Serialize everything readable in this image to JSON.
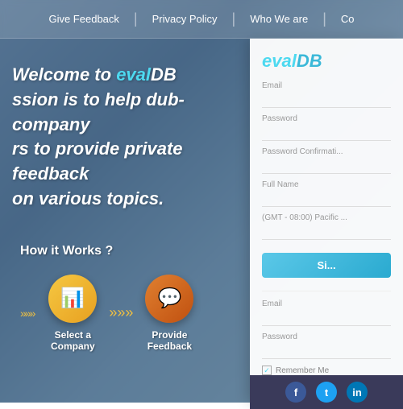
{
  "navbar": {
    "links": [
      {
        "label": "Give Feedback",
        "name": "give-feedback-link"
      },
      {
        "label": "Privacy Policy",
        "name": "privacy-policy-link"
      },
      {
        "label": "Who We are",
        "name": "who-we-are-link"
      },
      {
        "label": "Co",
        "name": "contact-link"
      }
    ]
  },
  "hero": {
    "welcome_line1": "Welcome to ",
    "brand_eval": "eval",
    "brand_db": "DB",
    "tagline_lines": [
      "ssion is to help dub-company",
      "rs to provide private feedback",
      "on various topics."
    ]
  },
  "how_it_works": {
    "title": "How it Works ?",
    "steps": [
      {
        "label": "Select a Company",
        "icon": "📊",
        "style": "yellow"
      },
      {
        "label": "Provide Feedback",
        "icon": "💬",
        "style": "orange"
      }
    ]
  },
  "signup_card": {
    "brand_eval": "eval",
    "brand_db": "DB",
    "fields": [
      {
        "label": "Email",
        "name": "email-signup"
      },
      {
        "label": "Password",
        "name": "password-signup"
      },
      {
        "label": "Password Confirmati...",
        "name": "password-confirm"
      },
      {
        "label": "Full Name",
        "name": "full-name"
      },
      {
        "label": "(GMT - 08:00) Pacific ...",
        "name": "timezone"
      }
    ],
    "signup_btn": "Si...",
    "signin": {
      "email_label": "Email",
      "password_label": "Password",
      "remember_label": "Remember Me"
    }
  },
  "social": {
    "icons": [
      {
        "label": "f",
        "name": "facebook",
        "class": "fb-icon"
      },
      {
        "label": "t",
        "name": "twitter",
        "class": "tw-icon"
      },
      {
        "label": "in",
        "name": "linkedin",
        "class": "li-icon"
      }
    ]
  }
}
